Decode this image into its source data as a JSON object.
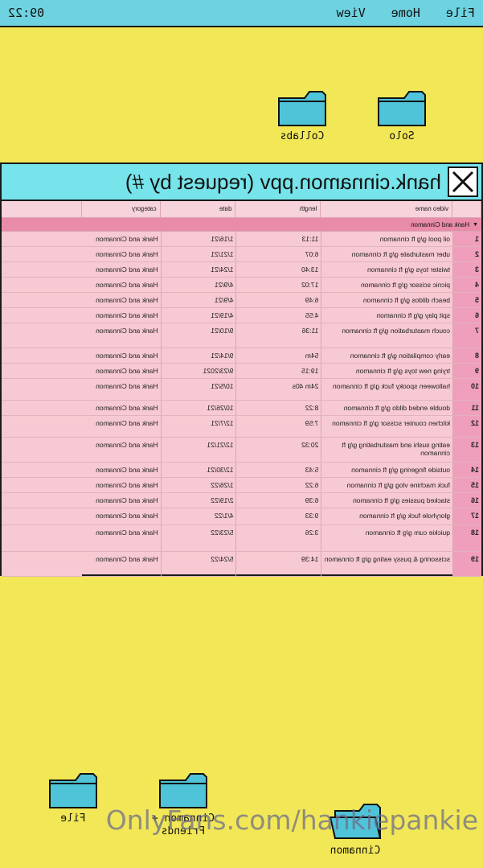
{
  "menubar": {
    "items": [
      "File",
      "Home",
      "View"
    ],
    "clock": "09:22"
  },
  "desktop": {
    "folders_top": [
      {
        "label": "Solo"
      },
      {
        "label": "Collabs"
      }
    ],
    "folders_bottom": [
      {
        "label": "File"
      },
      {
        "label": "Cinnamon + Friends"
      },
      {
        "label": "Cinnamon"
      }
    ],
    "folder_color": "#4fc4d8"
  },
  "window": {
    "title": "hank.cinnamon.ppv (request by #)",
    "close_icon": "close-x-icon",
    "columns": {
      "video_name": "video name",
      "length": "length",
      "date": "date",
      "category": "category"
    },
    "group_label": "Hank and Cinnamon",
    "rows": [
      {
        "num": "1",
        "name": "oil pool g/g ft cinnamon",
        "length": "11:13",
        "date": "1/16/21",
        "category": "Hank and Cinnamon"
      },
      {
        "num": "2",
        "name": "uber masturbate g/g ft cinnamon",
        "length": "6:07",
        "date": "1/21/21",
        "category": "Hank and Cinnamon"
      },
      {
        "num": "3",
        "name": "twister toys g/g ft cinnamon",
        "length": "13:40",
        "date": "1/24/21",
        "category": "Hank and Cinnamon"
      },
      {
        "num": "4",
        "name": "picnic scissor g/g ft cinnamon",
        "length": "17:02",
        "date": "4/9/21",
        "category": "Hank and Cinnamon"
      },
      {
        "num": "5",
        "name": "beach dildos g/g ft cinnamon",
        "length": "6:49",
        "date": "4/9/21",
        "category": "Hank and Cinnamon"
      },
      {
        "num": "6",
        "name": "spit play g/g ft cinnamon",
        "length": "4:55",
        "date": "4/19/21",
        "category": "Hank and Cinnamon"
      },
      {
        "num": "7",
        "name": "couch masturbation g/g ft cinnamon",
        "length": "11:36",
        "date": "9/10/21",
        "category": "Hank and Cinnamon"
      },
      {
        "num": "8",
        "name": "early compilation g/g ft cinnamon",
        "length": "54m",
        "date": "9/14/21",
        "category": "Hank and Cinnamon"
      },
      {
        "num": "9",
        "name": "trying new toys g/g ft cinnamon",
        "length": "19:15",
        "date": "9/23/2021",
        "category": "Hank and Cinnamon"
      },
      {
        "num": "10",
        "name": "halloween spooky fuck g/g ft cinnamon",
        "length": "24m 40s",
        "date": "10/5/21",
        "category": "Hank and Cinnamon"
      },
      {
        "num": "11",
        "name": "double ended dildo g/g ft cinnamon",
        "length": "8:22",
        "date": "10/26/21",
        "category": "Hank and Cinnamon"
      },
      {
        "num": "12",
        "name": "kitchen counter scissor g/g ft cinnamon",
        "length": "7:59",
        "date": "12/7/21",
        "category": "Hank and Cinnamon"
      },
      {
        "num": "13",
        "name": "eating sushi and masturbating g/g ft cinnamon",
        "length": "20:32",
        "date": "12/21/21",
        "category": "Hank and Cinnamon"
      },
      {
        "num": "14",
        "name": "outside fingering g/g ft cinnamon",
        "length": "5:43",
        "date": "12/30/21",
        "category": "Hank and Cinnamon"
      },
      {
        "num": "15",
        "name": "fuck machine vlog g/g ft cinnamon",
        "length": "6:22",
        "date": "1/26/22",
        "category": "Hank and Cinnamon"
      },
      {
        "num": "16",
        "name": "stacked pussies g/g ft cinnamon",
        "length": "6:39",
        "date": "2/19/22",
        "category": "Hank and Cinnamon"
      },
      {
        "num": "17",
        "name": "gloryhole fuck g/g ft cinnamon",
        "length": "9:33",
        "date": "4/1/22",
        "category": "Hank and Cinnamon"
      },
      {
        "num": "18",
        "name": "quickie cum g/g ft cinnamon",
        "length": "3:26",
        "date": "5/23/22",
        "category": "Hank and Cinnamon"
      },
      {
        "num": "19",
        "name": "scissoring & pussy eating g/g ft cinnamon",
        "length": "14:39",
        "date": "5/24/22",
        "category": "Hank and Cinnamon"
      }
    ]
  },
  "watermark": "OnlyFans.com/hankiepankie"
}
